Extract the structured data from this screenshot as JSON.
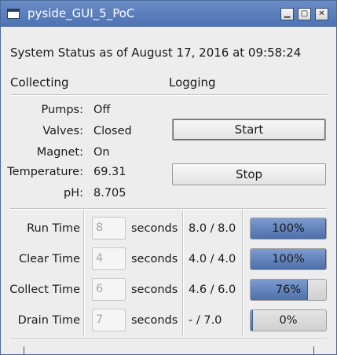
{
  "window": {
    "title": "pyside_GUI_5_PoC",
    "icon": "app-window-icon",
    "controls": {
      "minimize": "▁",
      "maximize": "▢",
      "close": "✕"
    }
  },
  "status": {
    "text": "System Status as of August 17, 2016 at 09:58:24"
  },
  "sections": {
    "collecting": "Collecting",
    "logging": "Logging"
  },
  "readings": [
    {
      "label": "Pumps:",
      "value": "Off"
    },
    {
      "label": "Valves:",
      "value": "Closed"
    },
    {
      "label": "Magnet:",
      "value": "On"
    },
    {
      "label": "Temperature:",
      "value": "69.31"
    },
    {
      "label": "pH:",
      "value": "8.705"
    }
  ],
  "buttons": {
    "start": "Start",
    "stop": "Stop"
  },
  "timers": [
    {
      "label": "Run Time",
      "input": "8",
      "unit": "seconds",
      "elapsed": "8.0",
      "sep": "/",
      "total": "8.0",
      "progress_text": "100%",
      "progress": 1.0
    },
    {
      "label": "Clear Time",
      "input": "4",
      "unit": "seconds",
      "elapsed": "4.0",
      "sep": "/",
      "total": "4.0",
      "progress_text": "100%",
      "progress": 1.0
    },
    {
      "label": "Collect Time",
      "input": "6",
      "unit": "seconds",
      "elapsed": "4.6",
      "sep": "/",
      "total": "6.0",
      "progress_text": "76%",
      "progress": 0.76
    },
    {
      "label": "Drain Time",
      "input": "7",
      "unit": "seconds",
      "elapsed": "-",
      "sep": "/",
      "total": "7.0",
      "progress_text": "0%",
      "progress": 0.0
    }
  ],
  "colors": {
    "titlebar": "#5a7dbd",
    "progress_fill": "#5b7db8",
    "background": "#ededed"
  }
}
